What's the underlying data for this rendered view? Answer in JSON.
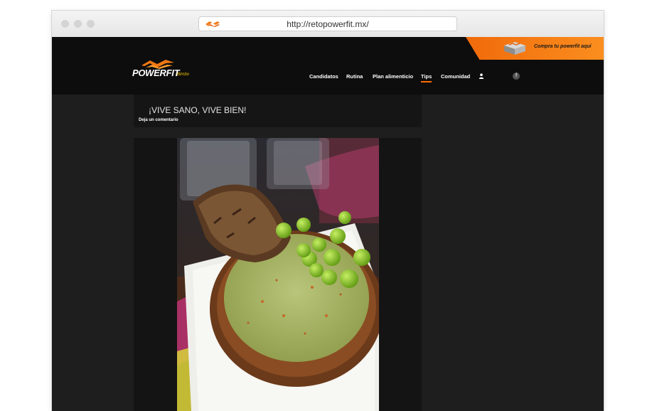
{
  "browser": {
    "url": "http://retopowerfit.mx/"
  },
  "header": {
    "logo_text": "POWERFIT",
    "logo_sub": "Bimbo",
    "promo_text": "Compra tu powerfit aquí",
    "accent_color": "#ff6a00",
    "nav": [
      {
        "label": "Candidatos"
      },
      {
        "label": "Rutina"
      },
      {
        "label": "Plan alimenticio"
      },
      {
        "label": "Tips",
        "active": true
      },
      {
        "label": "Comunidad"
      }
    ],
    "icons": [
      "user-icon",
      "facebook-icon"
    ]
  },
  "post": {
    "title": "¡VIVE SANO, VIVE BIEN!",
    "comment_link": "Deja un comentario"
  }
}
